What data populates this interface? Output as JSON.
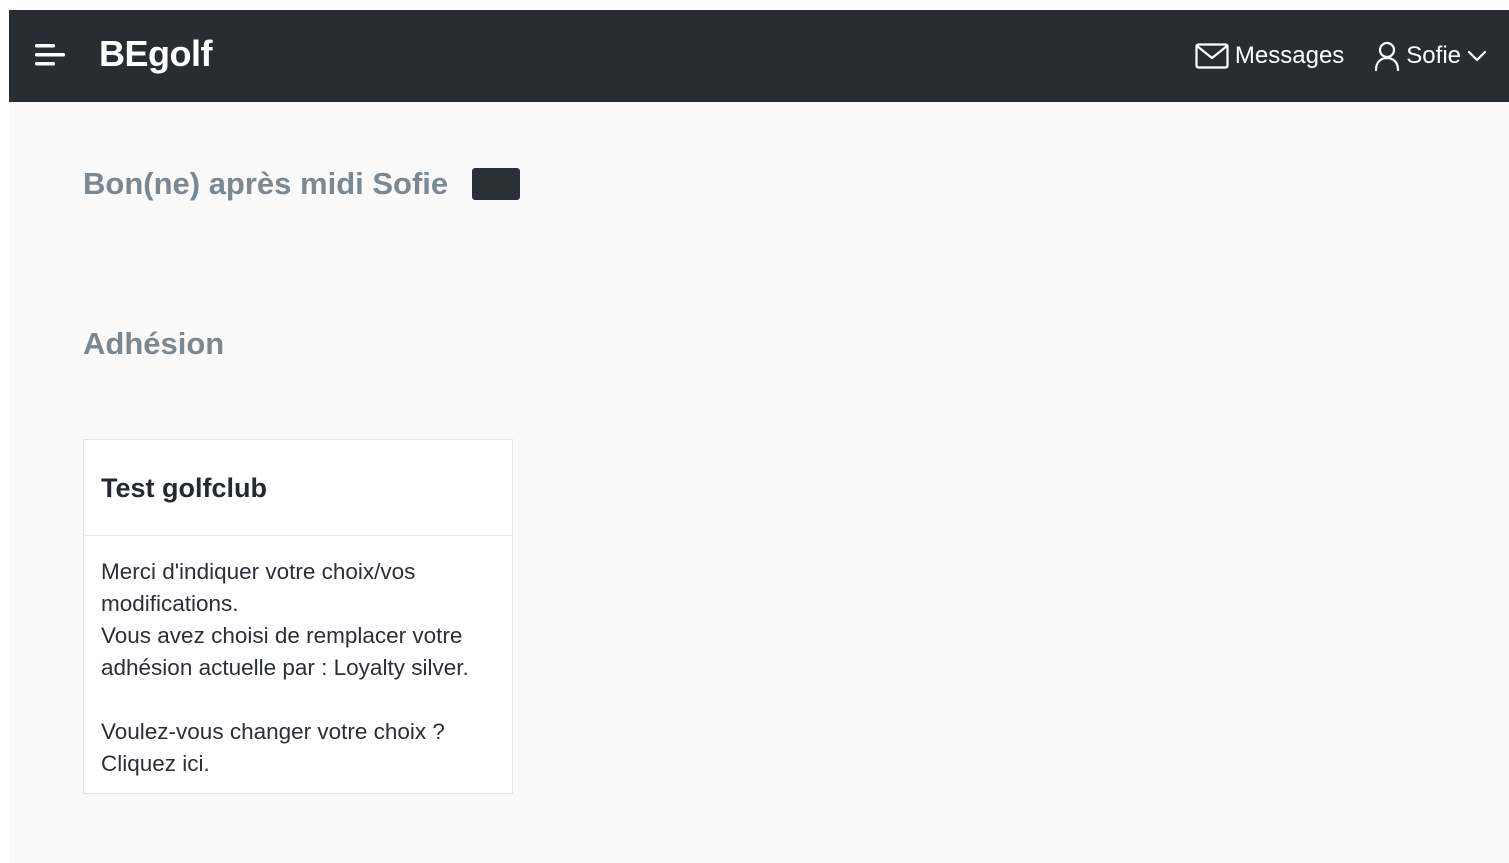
{
  "header": {
    "brand": "BEgolf",
    "messages_label": "Messages",
    "user_label": "Sofie"
  },
  "greeting": {
    "text": "Bon(ne) après midi Sofie"
  },
  "section": {
    "title": "Adhésion"
  },
  "card": {
    "title": "Test golfclub",
    "line1": "Merci d'indiquer votre choix/vos",
    "line2": "modifications.",
    "line3": "Vous avez choisi de remplacer votre",
    "line4": "adhésion actuelle par : Loyalty silver.",
    "line5": "Voulez-vous changer votre choix ?",
    "line6": "Cliquez ici."
  },
  "colors": {
    "navbar_bg": "#292d33",
    "heading": "#7a8894",
    "page_bg": "#fafafa"
  }
}
